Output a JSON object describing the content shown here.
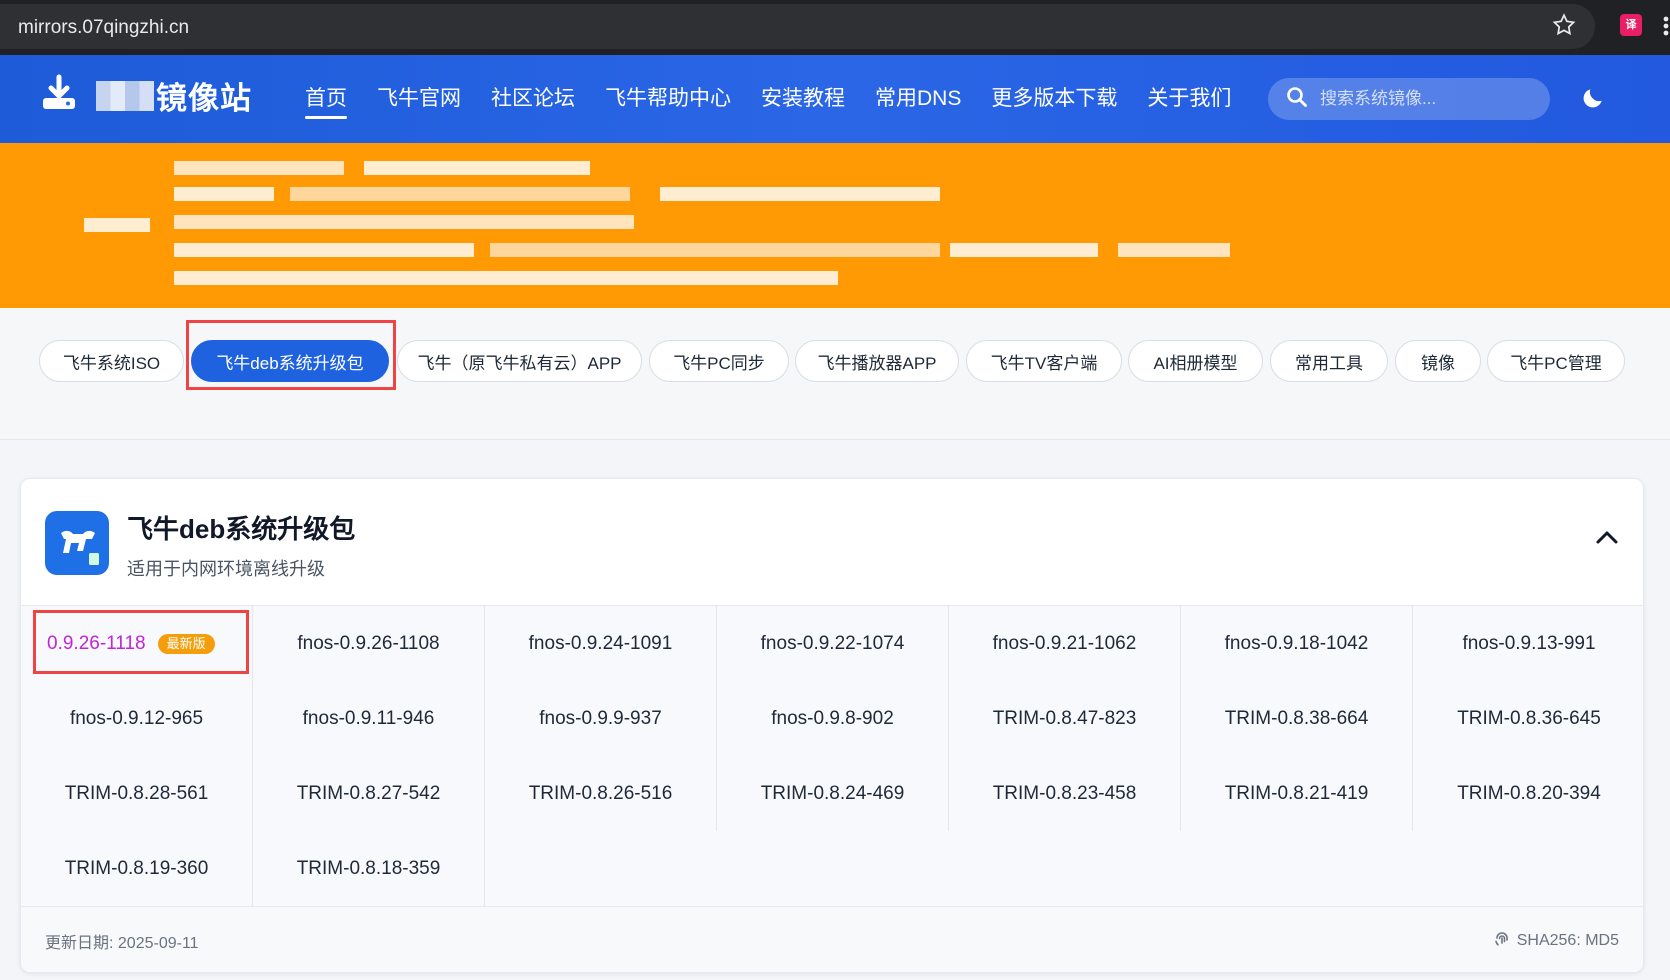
{
  "browser": {
    "url": "mirrors.07qingzhi.cn"
  },
  "header": {
    "logo_text": "镜像站",
    "nav": [
      {
        "label": "首页",
        "active": true
      },
      {
        "label": "飞牛官网"
      },
      {
        "label": "社区论坛"
      },
      {
        "label": "飞牛帮助中心"
      },
      {
        "label": "安装教程"
      },
      {
        "label": "常用DNS"
      },
      {
        "label": "更多版本下载"
      },
      {
        "label": "关于我们"
      }
    ],
    "search_placeholder": "搜索系统镜像..."
  },
  "tabs": [
    {
      "label": "飞牛系统ISO"
    },
    {
      "label": "飞牛deb系统升级包",
      "active": true
    },
    {
      "label": "飞牛（原飞牛私有云）APP"
    },
    {
      "label": "飞牛PC同步"
    },
    {
      "label": "飞牛播放器APP"
    },
    {
      "label": "飞牛TV客户端"
    },
    {
      "label": "AI相册模型"
    },
    {
      "label": "常用工具"
    },
    {
      "label": "镜像"
    },
    {
      "label": "飞牛PC管理"
    }
  ],
  "card": {
    "title": "飞牛deb系统升级包",
    "subtitle": "适用于内网环境离线升级",
    "latest_badge": "最新版",
    "versions": [
      "0.9.26-1118",
      "fnos-0.9.26-1108",
      "fnos-0.9.24-1091",
      "fnos-0.9.22-1074",
      "fnos-0.9.21-1062",
      "fnos-0.9.18-1042",
      "fnos-0.9.13-991",
      "fnos-0.9.12-965",
      "fnos-0.9.11-946",
      "fnos-0.9.9-937",
      "fnos-0.9.8-902",
      "TRIM-0.8.47-823",
      "TRIM-0.8.38-664",
      "TRIM-0.8.36-645",
      "TRIM-0.8.28-561",
      "TRIM-0.8.27-542",
      "TRIM-0.8.26-516",
      "TRIM-0.8.24-469",
      "TRIM-0.8.23-458",
      "TRIM-0.8.21-419",
      "TRIM-0.8.20-394",
      "TRIM-0.8.19-360",
      "TRIM-0.8.18-359"
    ],
    "update_date": "更新日期: 2025-09-11",
    "hash_info": "SHA256: MD5"
  },
  "colors": {
    "primary": "#1f62e0",
    "banner": "#ff9a05",
    "highlight": "#ef4444",
    "badge": "#f59e0b"
  }
}
